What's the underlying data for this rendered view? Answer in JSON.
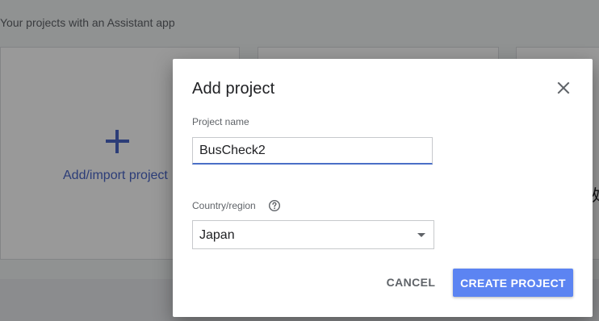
{
  "background": {
    "heading": "Your projects with an Assistant app",
    "add_card_label": "Add/import project",
    "add_icon": "plus-icon",
    "partial_card_glyph": "処"
  },
  "dialog": {
    "title": "Add project",
    "close_icon": "close-icon",
    "project_name": {
      "label": "Project name",
      "value": "BusCheck2"
    },
    "country": {
      "label": "Country/region",
      "help_icon": "help-circle-icon",
      "selected": "Japan",
      "dropdown_icon": "dropdown-arrow-icon"
    },
    "buttons": {
      "cancel": "CANCEL",
      "create": "CREATE PROJECT"
    }
  },
  "colors": {
    "primary": "#5c84f2",
    "accent_blue": "#4a66c9",
    "input_underline": "#4a6fc7"
  }
}
